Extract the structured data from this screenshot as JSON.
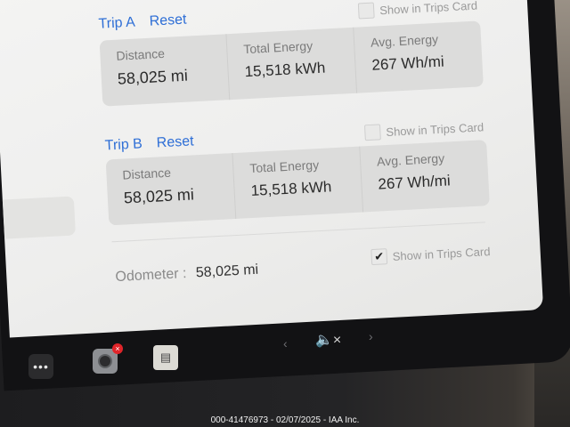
{
  "trip_a": {
    "title": "Trip A",
    "reset": "Reset",
    "show_label": "Show in Trips Card",
    "checked": false,
    "distance_label": "Distance",
    "distance": "58,025 mi",
    "energy_label": "Total Energy",
    "energy": "15,518 kWh",
    "avg_label": "Avg. Energy",
    "avg": "267 Wh/mi"
  },
  "trip_b": {
    "title": "Trip B",
    "reset": "Reset",
    "show_label": "Show in Trips Card",
    "checked": false,
    "distance_label": "Distance",
    "distance": "58,025 mi",
    "energy_label": "Total Energy",
    "energy": "15,518 kWh",
    "avg_label": "Avg. Energy",
    "avg": "267 Wh/mi"
  },
  "odometer": {
    "label": "Odometer",
    "separator": ":",
    "value": "58,025 mi",
    "show_label": "Show in Trips Card",
    "checked": true,
    "check_glyph": "✔"
  },
  "taskbar": {
    "more_glyph": "•••",
    "camera_badge": "×",
    "notes_glyph": "▤",
    "chevron_left": "‹",
    "chevron_right": "›",
    "mute_glyph": "🔈×"
  },
  "caption": "000-41476973 - 02/07/2025 - IAA Inc.",
  "colors": {
    "link": "#2f6fd6",
    "badge": "#e0252a"
  }
}
